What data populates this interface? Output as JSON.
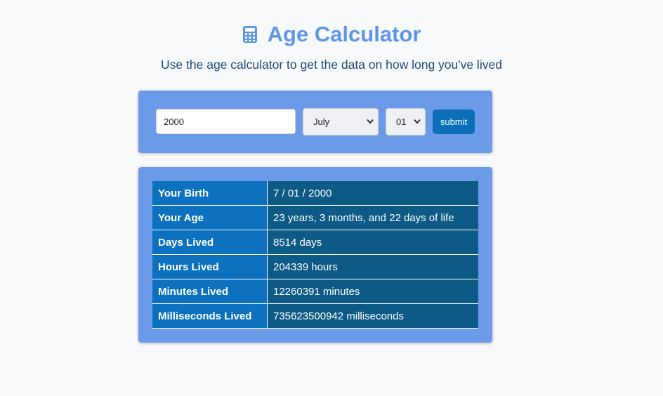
{
  "header": {
    "title": "Age Calculator",
    "subtitle": "Use the age calculator to get the data on how long you've lived",
    "icon": "calculator-icon"
  },
  "form": {
    "year_value": "2000",
    "month_selected": "July",
    "day_selected": "01",
    "submit_label": "submit"
  },
  "results": {
    "rows": [
      {
        "label": "Your Birth",
        "value": "7 / 01 / 2000"
      },
      {
        "label": "Your Age",
        "value": "23 years, 3 months, and 22 days of life"
      },
      {
        "label": "Days Lived",
        "value": "8514 days"
      },
      {
        "label": "Hours Lived",
        "value": "204339 hours"
      },
      {
        "label": "Minutes Lived",
        "value": "12260391 minutes"
      },
      {
        "label": "Milliseconds Lived",
        "value": "735623500942 milliseconds"
      }
    ]
  },
  "colors": {
    "title": "#6096e8",
    "subtitle": "#1b4a7a",
    "card": "#6b9ae8",
    "submit": "#0a6fb8",
    "label_cell": "#0c72c0",
    "value_cell": "#0c5a85",
    "background": "#f8f9fa"
  }
}
